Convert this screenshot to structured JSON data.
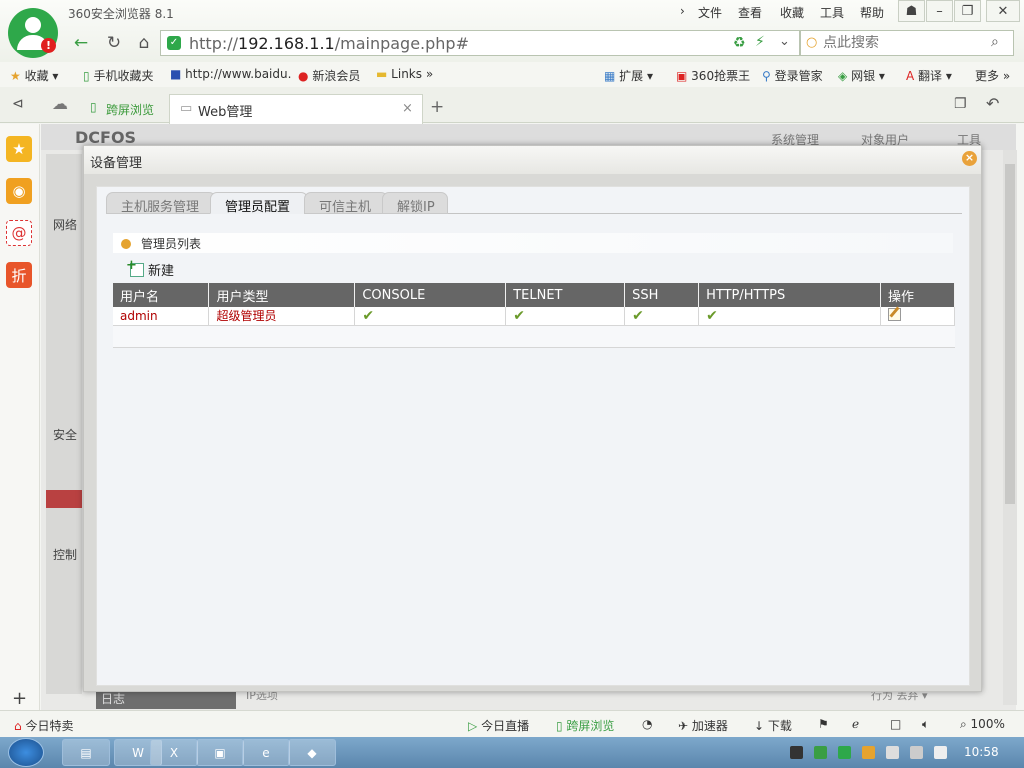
{
  "browser": {
    "app_title": "360安全浏览器 8.1",
    "menus": [
      "文件",
      "查看",
      "收藏",
      "工具",
      "帮助"
    ],
    "address": {
      "scheme": "http://",
      "host": "192.168.1.1",
      "path": "/mainpage.php#"
    },
    "search_placeholder": "点此搜索",
    "bookmarks": [
      "收藏",
      "手机收藏夹",
      "http://www.baidu.",
      "新浪会员",
      "Links"
    ],
    "bookmark_tools": [
      "扩展",
      "360抢票王",
      "登录管家",
      "网银",
      "翻译",
      "更多"
    ],
    "tabs": [
      {
        "label": "跨屏浏览"
      },
      {
        "label": "Web管理"
      }
    ]
  },
  "background_app": {
    "brand": "DCFOS",
    "menus": [
      "系统管理",
      "对象用户",
      "工具"
    ],
    "sections": [
      "网络",
      "安全",
      "控制"
    ],
    "bottom_label": "日志",
    "filter_label": "IP选项",
    "behavior_label": "行为",
    "behavior_value": "丢弃"
  },
  "dialog": {
    "title": "设备管理",
    "tabs": [
      "主机服务管理",
      "管理员配置",
      "可信主机",
      "解锁IP"
    ],
    "active_tab": 1,
    "section_title": "管理员列表",
    "new_button": "新建",
    "columns": [
      "用户名",
      "用户类型",
      "CONSOLE",
      "TELNET",
      "SSH",
      "HTTP/HTTPS",
      "操作"
    ],
    "rows": [
      {
        "username": "admin",
        "user_type": "超级管理员",
        "console": true,
        "telnet": true,
        "ssh": true,
        "http": true
      }
    ],
    "check_glyph": "✔"
  },
  "statusbar": {
    "left": "今日特卖",
    "items": [
      "今日直播",
      "跨屏浏览",
      "加速器",
      "下载"
    ],
    "zoom": "100%"
  },
  "taskbar": {
    "clock": "10:58"
  },
  "colors": {
    "accent_green": "#2ea84a",
    "header_gray": "#666666",
    "value_red": "#b00000",
    "section_dot": "#e5a32f"
  }
}
